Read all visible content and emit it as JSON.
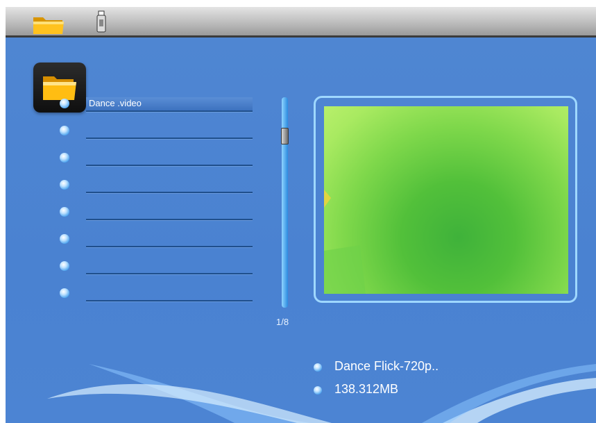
{
  "toolbar": {
    "icons": [
      "folder-icon",
      "usb-drive-icon"
    ]
  },
  "browser": {
    "folder_icon": "folder-icon",
    "files": [
      {
        "label": "Dance .video",
        "selected": true
      },
      {
        "label": "",
        "selected": false
      },
      {
        "label": "",
        "selected": false
      },
      {
        "label": "",
        "selected": false
      },
      {
        "label": "",
        "selected": false
      },
      {
        "label": "",
        "selected": false
      },
      {
        "label": "",
        "selected": false
      },
      {
        "label": "",
        "selected": false
      }
    ],
    "page_indicator": "1/8"
  },
  "preview": {
    "file_name": "Dance Flick-720p..",
    "file_size": "138.312MB"
  },
  "colors": {
    "background": "#4a82d1",
    "selection": "#3d72bf",
    "preview_border": "#9fd8ff"
  }
}
